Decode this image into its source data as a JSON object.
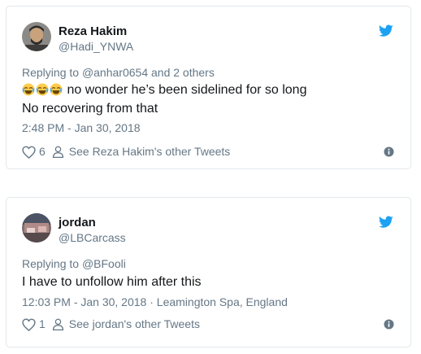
{
  "colors": {
    "twitter_blue": "#1da1f2",
    "secondary_text": "#657786",
    "primary_text": "#14171a",
    "border": "#e1e8ed"
  },
  "tweets": [
    {
      "name": "Reza Hakim",
      "handle": "@Hadi_YNWA",
      "replying_prefix": "Replying to ",
      "replying_to": "@anhar0654",
      "replying_suffix": " and 2 others",
      "emoji": [
        "face-with-tears-of-joy",
        "face-with-tears-of-joy",
        "face-with-tears-of-joy"
      ],
      "text_line1": " no wonder he’s been sidelined for so long",
      "text_line2": "No recovering from that",
      "timestamp": "2:48 PM - Jan 30, 2018",
      "location": "",
      "likes": "6",
      "other_tweets": "See Reza Hakim's other Tweets",
      "icons": {
        "like": "heart-icon",
        "profile": "person-icon",
        "info": "info-icon",
        "brand": "twitter-bird-icon"
      }
    },
    {
      "name": "jordan",
      "handle": "@LBCarcass",
      "replying_prefix": "Replying to ",
      "replying_to": "@BFooli",
      "text_line1": "I have to unfollow him after this",
      "timestamp": "12:03 PM - Jan 30, 2018",
      "separator": " · ",
      "location": "Leamington Spa, England",
      "likes": "1",
      "other_tweets": "See jordan's other Tweets",
      "icons": {
        "like": "heart-icon",
        "profile": "person-icon",
        "info": "info-icon",
        "brand": "twitter-bird-icon"
      }
    }
  ]
}
